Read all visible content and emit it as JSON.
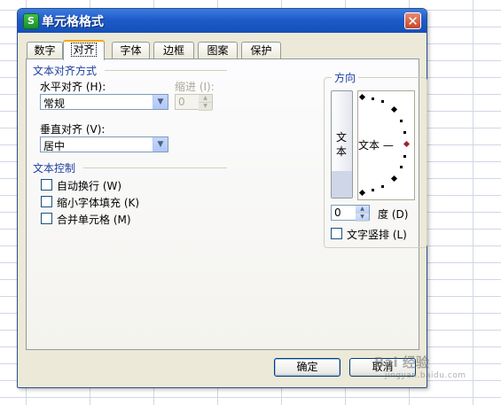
{
  "window": {
    "title": "单元格格式",
    "app_icon": "S",
    "close_label": "✕"
  },
  "tabs": [
    {
      "label": "数字",
      "active": false
    },
    {
      "label": "对齐",
      "active": true
    },
    {
      "label": "字体",
      "active": false
    },
    {
      "label": "边框",
      "active": false
    },
    {
      "label": "图案",
      "active": false
    },
    {
      "label": "保护",
      "active": false
    }
  ],
  "alignment": {
    "group_title": "文本对齐方式",
    "horizontal_label": "水平对齐 (H):",
    "horizontal_value": "常规",
    "indent_label": "缩进 (I):",
    "indent_value": "0",
    "vertical_label": "垂直对齐 (V):",
    "vertical_value": "居中"
  },
  "text_control": {
    "group_title": "文本控制",
    "options": [
      {
        "label": "自动换行 (W)",
        "checked": false
      },
      {
        "label": "缩小字体填充 (K)",
        "checked": false
      },
      {
        "label": "合并单元格 (M)",
        "checked": false
      }
    ]
  },
  "orientation": {
    "group_title": "方向",
    "vertical_text": "文本",
    "dial_text": "文本 —",
    "degrees_value": "0",
    "degrees_label": "度 (D)",
    "vertical_stack_label": "文字竖排 (L)",
    "vertical_stack_checked": false,
    "pointer_color": "#a0202a"
  },
  "buttons": {
    "ok": "确定",
    "cancel": "取消"
  },
  "watermark": {
    "text": "Bai 经验",
    "sub": "jingyan.baidu.com"
  }
}
